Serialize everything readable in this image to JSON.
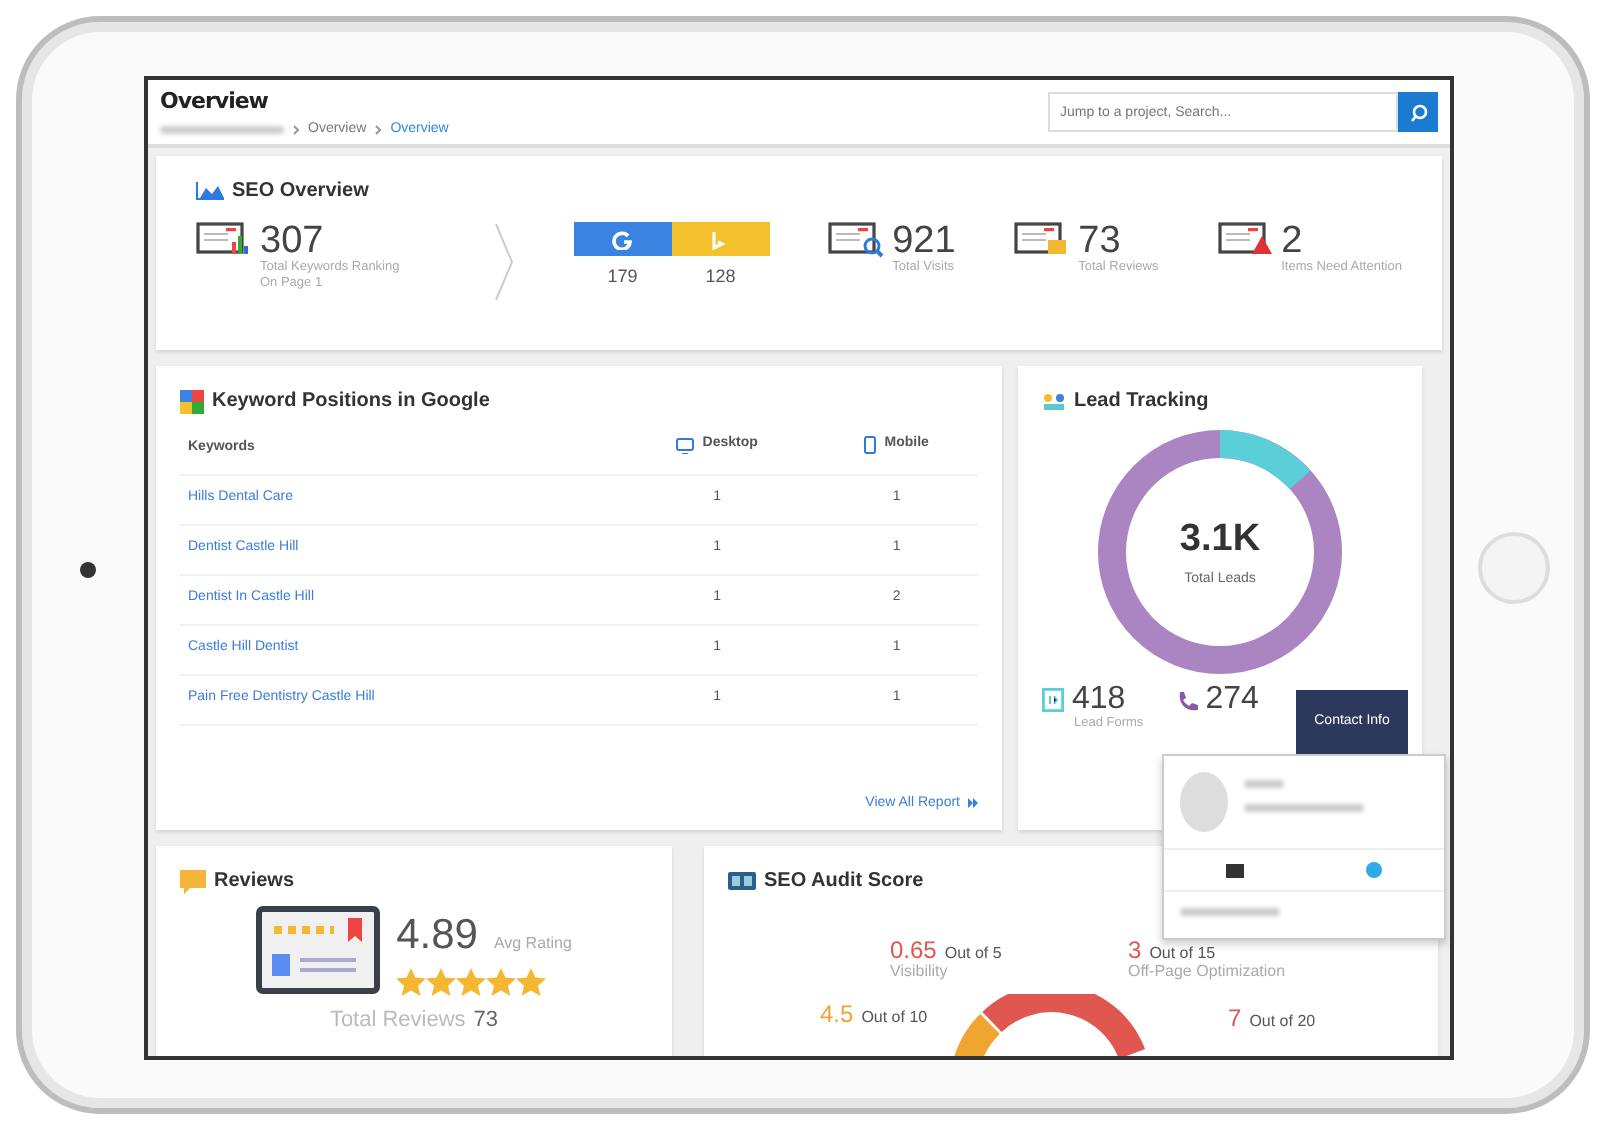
{
  "header": {
    "title": "Overview",
    "breadcrumb": [
      {
        "label": "Overview",
        "selected": false
      },
      {
        "label": "Overview",
        "selected": true
      }
    ],
    "search": {
      "placeholder": "Jump to a project, Search..."
    }
  },
  "seo_overview": {
    "title": "SEO Overview",
    "stats": [
      {
        "kind": "keywords",
        "value": "307",
        "label": "Total Keywords Ranking On Page 1"
      },
      {
        "kind": "engines",
        "engines": [
          {
            "kind": "google",
            "value": "179"
          },
          {
            "kind": "bing",
            "value": "128"
          }
        ]
      },
      {
        "kind": "visits",
        "value": "921",
        "label": "Total Visits"
      },
      {
        "kind": "reviews",
        "value": "73",
        "label": "Total Reviews"
      },
      {
        "kind": "attention",
        "value": "2",
        "label": "Items Need Attention"
      }
    ]
  },
  "keyword_positions": {
    "title": "Keyword Positions in Google",
    "columns": [
      "Keywords",
      "Desktop",
      "Mobile"
    ],
    "rows": [
      {
        "keyword": "Hills Dental Care",
        "desktop": "1",
        "mobile": "1"
      },
      {
        "keyword": "Dentist Castle Hill",
        "desktop": "1",
        "mobile": "1"
      },
      {
        "keyword": "Dentist In Castle Hill",
        "desktop": "1",
        "mobile": "2"
      },
      {
        "keyword": "Castle Hill Dentist",
        "desktop": "1",
        "mobile": "1"
      },
      {
        "keyword": "Pain Free Dentistry Castle Hill",
        "desktop": "1",
        "mobile": "1"
      }
    ],
    "link": "View All Report"
  },
  "lead_tracking": {
    "title": "Lead Tracking",
    "total": "3.1K",
    "total_label": "Total Leads",
    "stats": [
      {
        "kind": "form",
        "value": "418",
        "label": "Lead Forms"
      },
      {
        "kind": "call",
        "value": "274"
      }
    ]
  },
  "contact_popup": {
    "button": "Contact Info"
  },
  "reviews": {
    "title": "Reviews",
    "rating": "4.89",
    "rating_label": "Avg Rating",
    "stars": 5,
    "total_label": "Total Reviews",
    "total": "73"
  },
  "seo_audit": {
    "title": "SEO Audit Score",
    "items": [
      {
        "score": "0.65",
        "out_of": "Out of 5",
        "label": "Visibility",
        "color": "#e0574f"
      },
      {
        "score": "3",
        "out_of": "Out of 15",
        "label": "Off-Page Optimization",
        "color": "#e0574f"
      },
      {
        "score": "4.5",
        "out_of": "Out of 10",
        "color": "#f0a431"
      },
      {
        "score": "7",
        "out_of": "Out of 20",
        "color": "#e0574f"
      }
    ]
  }
}
